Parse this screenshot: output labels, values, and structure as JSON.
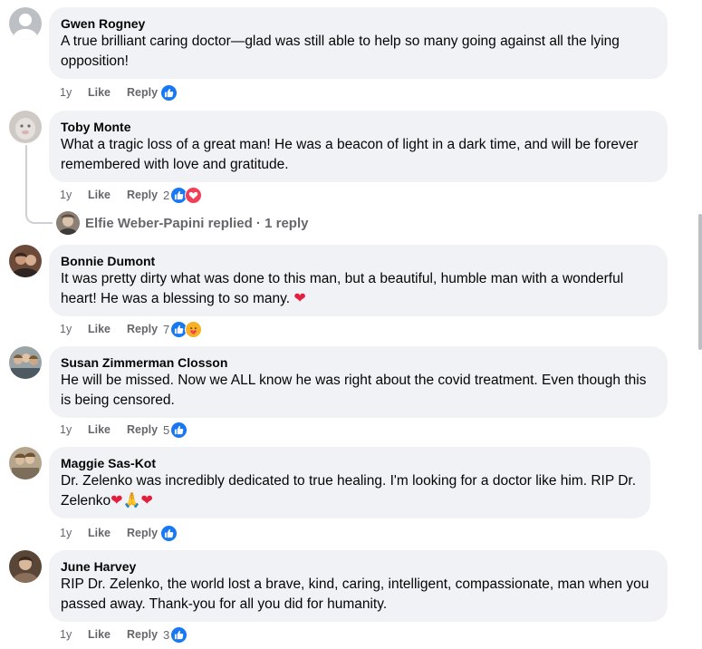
{
  "comments": [
    {
      "author": "Gwen Rogney",
      "text": "A true brilliant caring doctor—glad was still able to help so many going against all the lying opposition!",
      "time": "1y",
      "like": "Like",
      "reply": "Reply",
      "reaction_count": "",
      "reactions": [
        "like-reaction-icon"
      ]
    },
    {
      "author": "Toby Monte",
      "text": "What a tragic loss of a great man! He was a beacon of light in a dark time, and will be forever remembered with love and gratitude.",
      "time": "1y",
      "like": "Like",
      "reply": "Reply",
      "reaction_count": "2",
      "reactions": [
        "like-reaction-icon",
        "love-reaction-icon"
      ]
    },
    {
      "author": "Bonnie Dumont",
      "text": "It was pretty dirty what was done to this man, but a beautiful, humble man with a wonderful heart! He was a blessing to so many. ",
      "emoji": "❤",
      "time": "1y",
      "like": "Like",
      "reply": "Reply",
      "reaction_count": "7",
      "reactions": [
        "like-reaction-icon",
        "care-reaction-icon"
      ]
    },
    {
      "author": "Susan Zimmerman Closson",
      "text": "He will be missed. Now we ALL know he was right about the covid treatment. Even though this is being censored.",
      "time": "1y",
      "like": "Like",
      "reply": "Reply",
      "reaction_count": "5",
      "reactions": [
        "like-reaction-icon"
      ]
    },
    {
      "author": "Maggie Sas-Kot",
      "text": "Dr. Zelenko was incredibly dedicated to true healing. I'm looking for a doctor like him. RIP Dr. Zelenko",
      "emoji": "❤🙏❤",
      "time": "1y",
      "like": "Like",
      "reply": "Reply",
      "reaction_count": "",
      "reactions": [
        "like-reaction-icon"
      ]
    },
    {
      "author": "June Harvey",
      "text": "RIP Dr. Zelenko, the world lost a brave, kind, caring, intelligent, compassionate, man when you passed away. Thank-you for all you did for humanity.",
      "time": "1y",
      "like": "Like",
      "reply": "Reply",
      "reaction_count": "3",
      "reactions": [
        "like-reaction-icon"
      ]
    }
  ],
  "replies_summary": {
    "text": "Elfie Weber-Papini replied · 1 reply"
  },
  "colors": {
    "bubble": "#f0f2f5",
    "secondary_text": "#65676b",
    "like_blue": "#1877f2",
    "love_red": "#f33e58",
    "care_yellow": "#f7b125"
  }
}
